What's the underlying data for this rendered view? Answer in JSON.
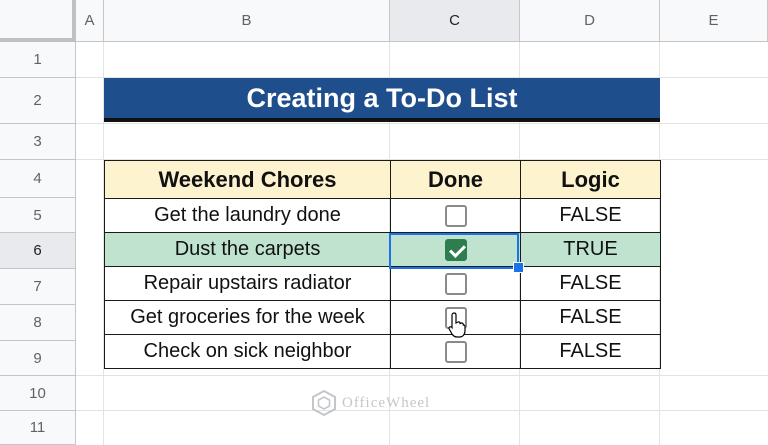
{
  "columns": [
    "A",
    "B",
    "C",
    "D",
    "E"
  ],
  "rows": [
    "1",
    "2",
    "3",
    "4",
    "5",
    "6",
    "7",
    "8",
    "9",
    "10",
    "11"
  ],
  "title": "Creating a To-Do List",
  "table": {
    "headers": [
      "Weekend Chores",
      "Done",
      "Logic"
    ],
    "items": [
      {
        "chore": "Get the laundry done",
        "done": false,
        "logic": "FALSE"
      },
      {
        "chore": "Dust the carpets",
        "done": true,
        "logic": "TRUE"
      },
      {
        "chore": "Repair upstairs radiator",
        "done": false,
        "logic": "FALSE"
      },
      {
        "chore": "Get groceries for the week",
        "done": false,
        "logic": "FALSE"
      },
      {
        "chore": "Check on sick neighbor",
        "done": false,
        "logic": "FALSE"
      }
    ]
  },
  "watermark": "OfficeWheel",
  "colors": {
    "title_bg": "#1f4e8c",
    "header_bg": "#fdf3cf",
    "highlight_row": "#bfe3cf",
    "checkbox_checked": "#2e7d4f",
    "selection": "#1a73e8"
  }
}
